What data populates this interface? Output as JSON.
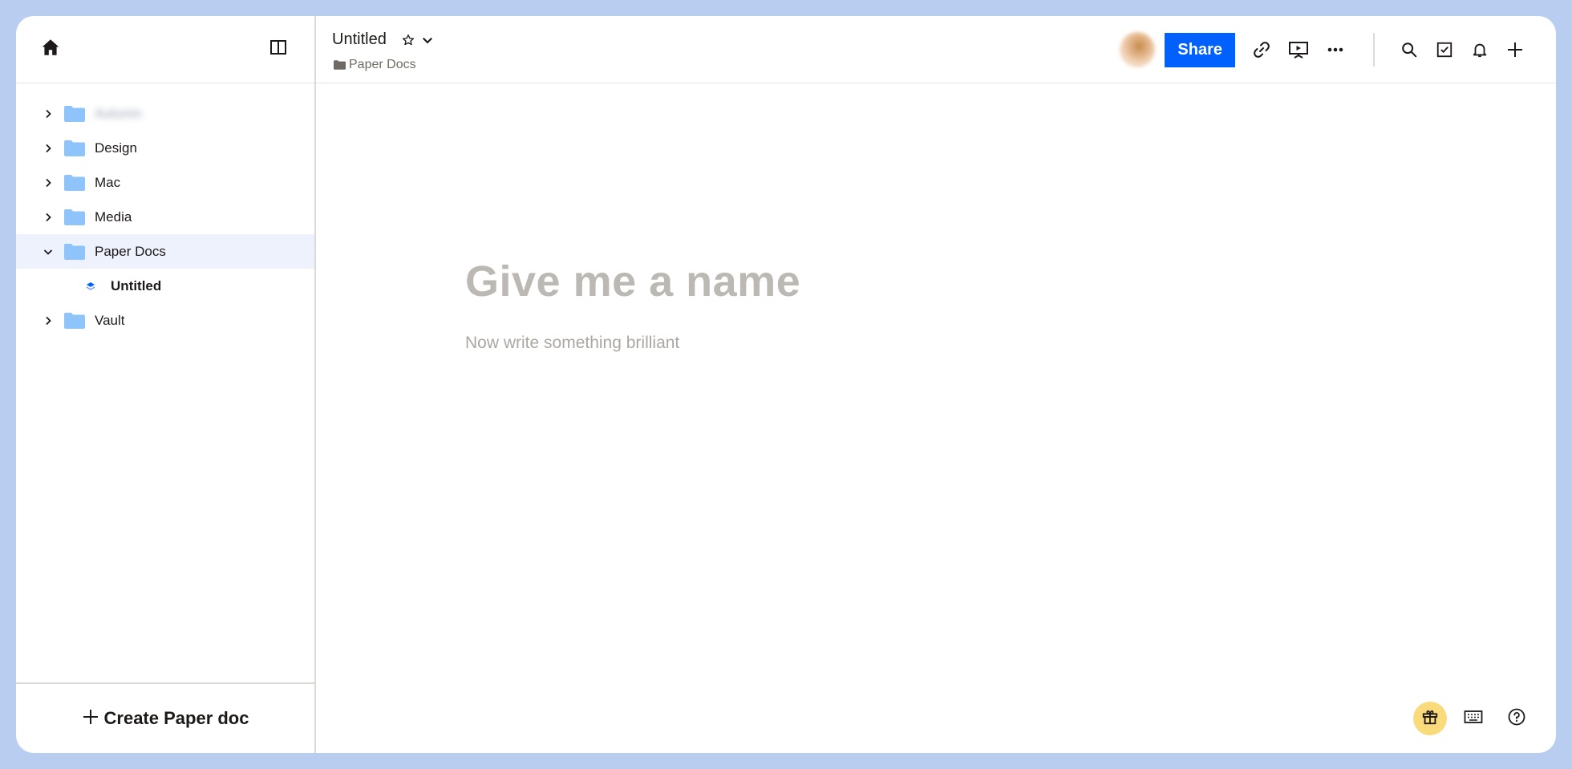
{
  "sidebar": {
    "items": [
      {
        "label": "Autumn",
        "expanded": false,
        "blurred": true
      },
      {
        "label": "Design",
        "expanded": false
      },
      {
        "label": "Mac",
        "expanded": false
      },
      {
        "label": "Media",
        "expanded": false
      },
      {
        "label": "Paper Docs",
        "expanded": true,
        "selected": true
      },
      {
        "label": "Vault",
        "expanded": false
      }
    ],
    "child_doc": {
      "label": "Untitled"
    },
    "create_label": "Create Paper doc"
  },
  "header": {
    "doc_title": "Untitled",
    "breadcrumb": "Paper Docs",
    "share_label": "Share"
  },
  "editor": {
    "title_placeholder": "Give me a name",
    "body_placeholder": "Now write something brilliant"
  },
  "colors": {
    "accent": "#0061fe",
    "background": "#b9cdf0",
    "folder": "#8fc4fb",
    "selected_row": "#edf2fd",
    "gift_bg": "#fadb7b"
  },
  "icons": [
    "home-icon",
    "sidebar-toggle-icon",
    "chevron-right-icon",
    "chevron-down-icon",
    "folder-icon",
    "paper-doc-icon",
    "star-icon",
    "link-icon",
    "present-icon",
    "more-icon",
    "search-icon",
    "checkbox-icon",
    "bell-icon",
    "plus-icon",
    "gift-icon",
    "keyboard-icon",
    "help-icon"
  ]
}
